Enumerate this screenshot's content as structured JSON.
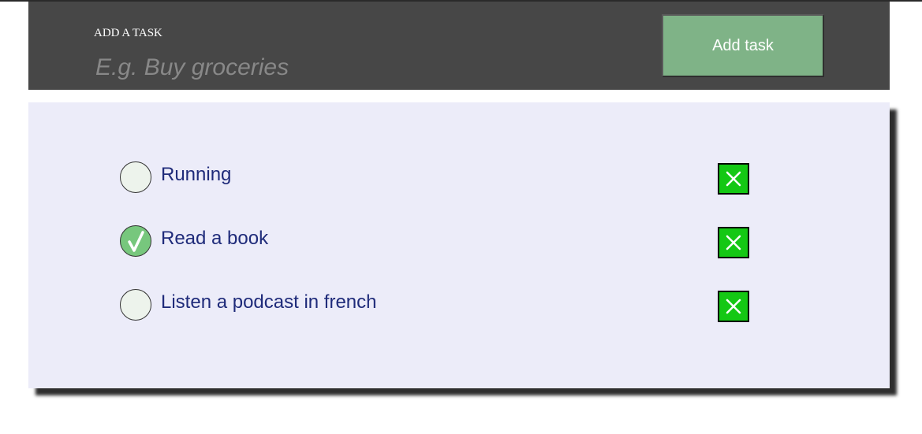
{
  "form": {
    "label": "ADD A TASK",
    "placeholder": "E.g. Buy groceries",
    "value": "",
    "add_button_label": "Add task"
  },
  "tasks": [
    {
      "label": "Running",
      "done": false
    },
    {
      "label": "Read a book",
      "done": true
    },
    {
      "label": "Listen a podcast in french",
      "done": false
    }
  ],
  "colors": {
    "header_bg": "#474747",
    "add_button_bg": "#7fb387",
    "panel_bg": "#ececf9",
    "task_text": "#1f2b7a",
    "done_circle": "#77c77d",
    "delete_bg": "#14c814"
  },
  "icons": {
    "check": "check-icon",
    "delete": "close-icon"
  }
}
